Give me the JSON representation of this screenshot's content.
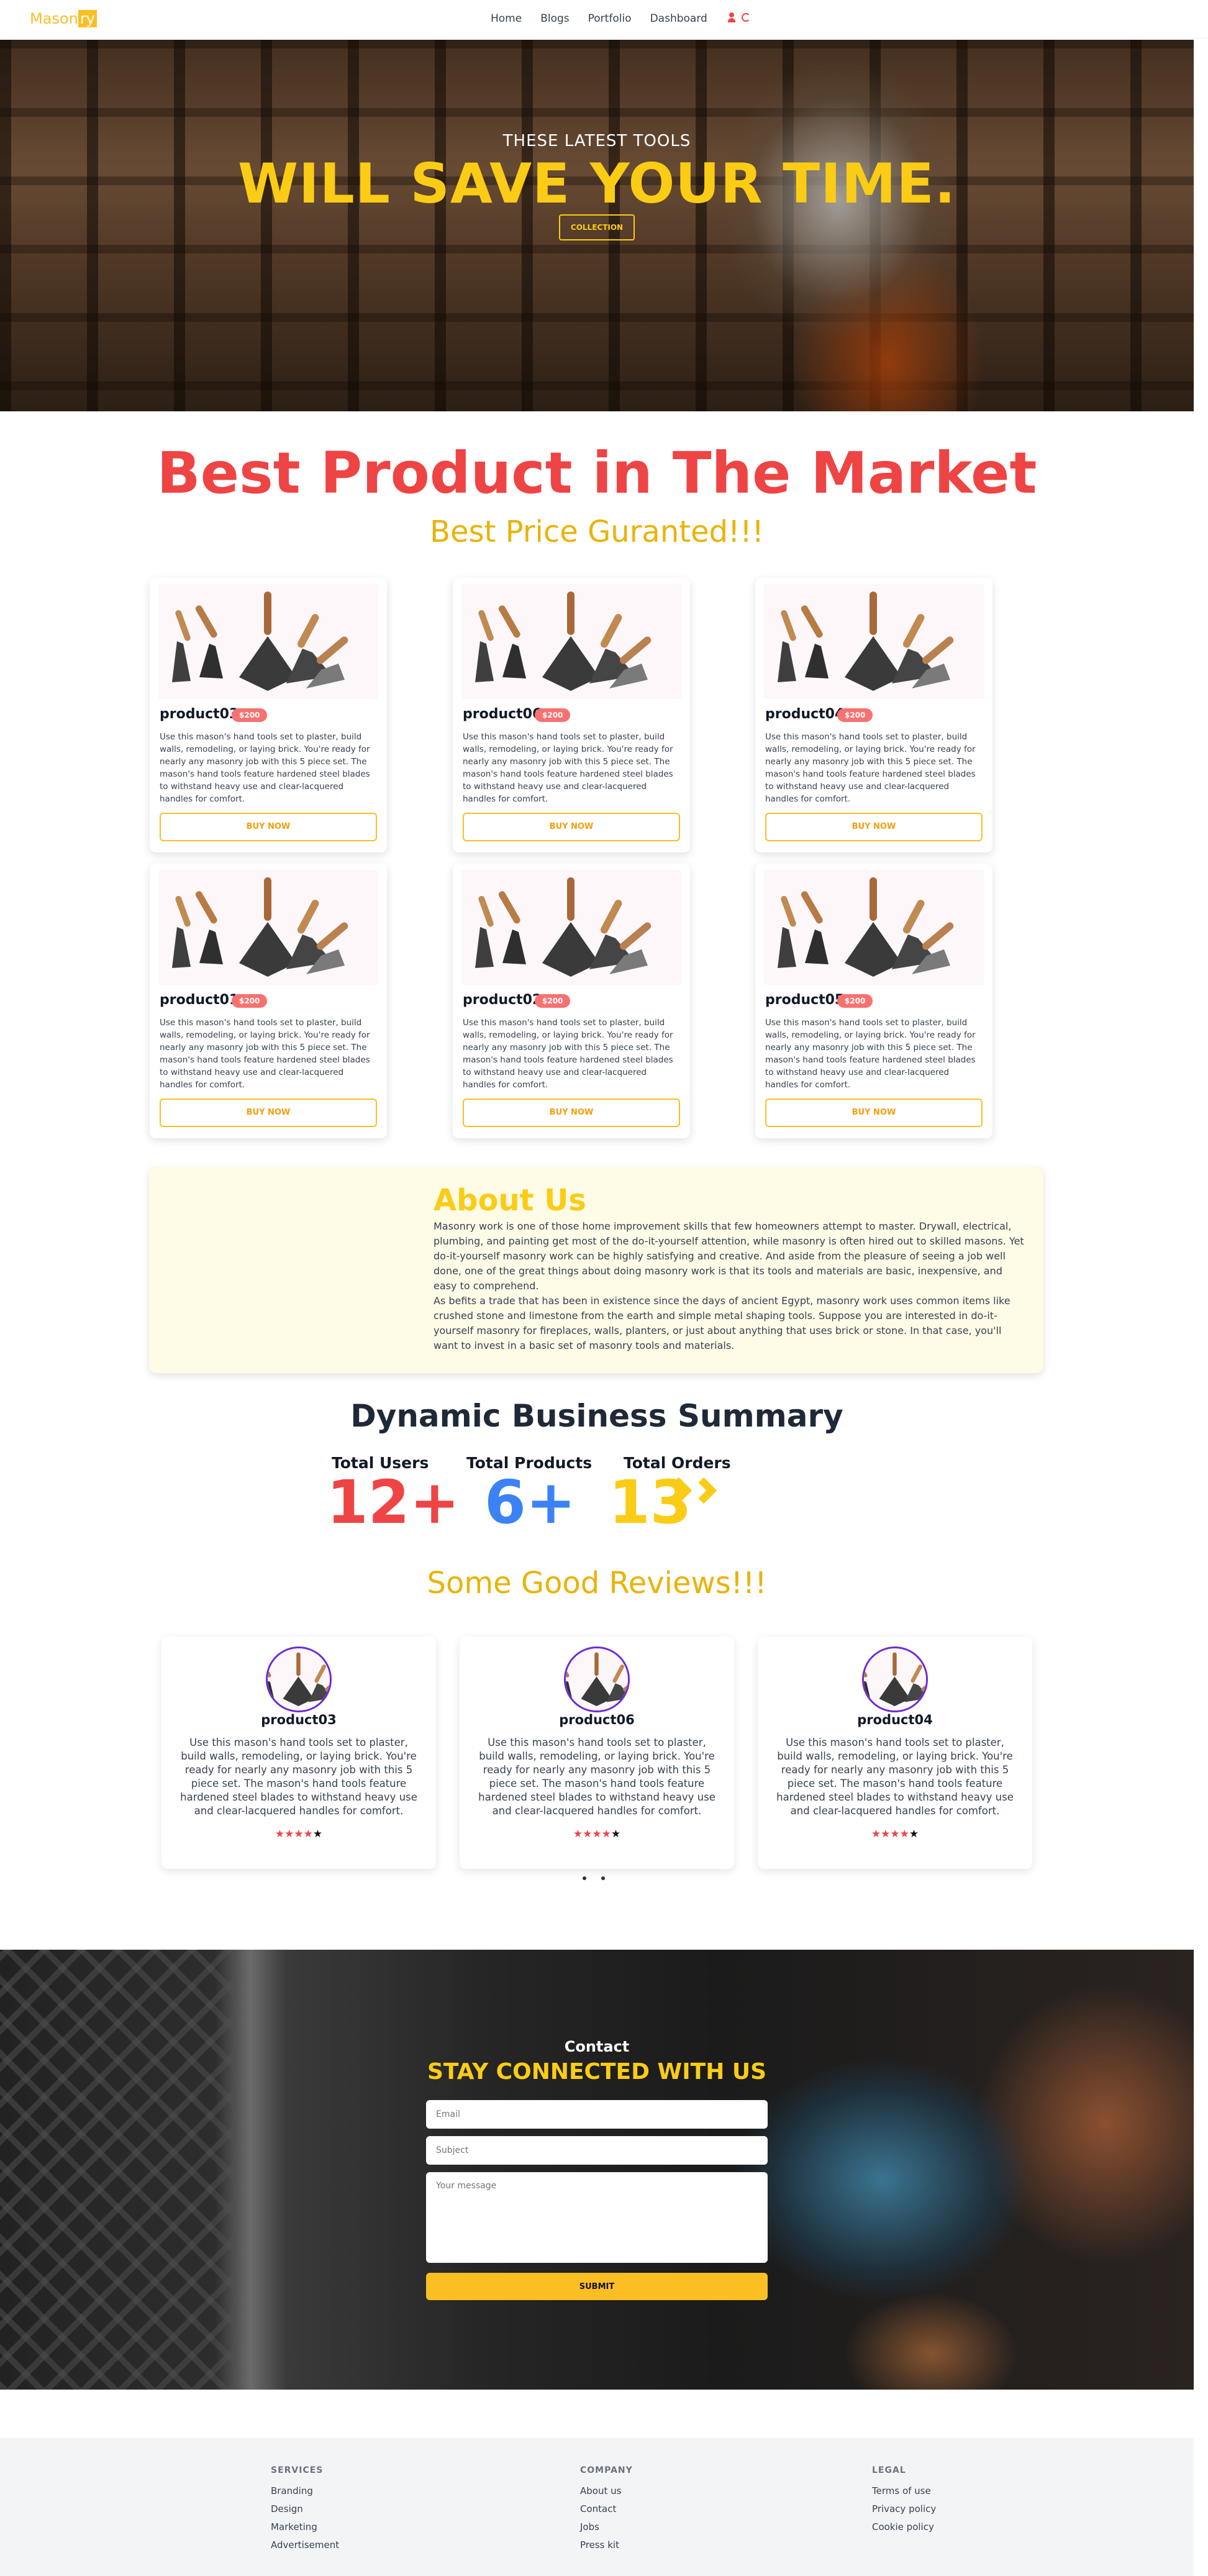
{
  "nav": {
    "logo_main": "Mason",
    "logo_box": "ry",
    "links": [
      "Home",
      "Blogs",
      "Portfolio",
      "Dashboard"
    ]
  },
  "hero": {
    "subtitle": "THESE LATEST TOOLS",
    "title": "WILL SAVE YOUR TIME.",
    "button": "COLLECTION"
  },
  "best": {
    "title": "Best Product in The Market",
    "subtitle": "Best Price Guranted!!!"
  },
  "products": [
    {
      "name": "product03",
      "price": "$200",
      "desc": "Use this mason's hand tools set to plaster, build walls, remodeling, or laying brick. You're ready for nearly any masonry job with this 5 piece set. The mason's hand tools feature hardened steel blades to withstand heavy use and clear-lacquered handles for comfort.",
      "button": "BUY NOW"
    },
    {
      "name": "product06",
      "price": "$200",
      "desc": "Use this mason's hand tools set to plaster, build walls, remodeling, or laying brick. You're ready for nearly any masonry job with this 5 piece set. The mason's hand tools feature hardened steel blades to withstand heavy use and clear-lacquered handles for comfort.",
      "button": "BUY NOW"
    },
    {
      "name": "product04",
      "price": "$200",
      "desc": "Use this mason's hand tools set to plaster, build walls, remodeling, or laying brick. You're ready for nearly any masonry job with this 5 piece set. The mason's hand tools feature hardened steel blades to withstand heavy use and clear-lacquered handles for comfort.",
      "button": "BUY NOW"
    },
    {
      "name": "product01",
      "price": "$200",
      "desc": "Use this mason's hand tools set to plaster, build walls, remodeling, or laying brick. You're ready for nearly any masonry job with this 5 piece set. The mason's hand tools feature hardened steel blades to withstand heavy use and clear-lacquered handles for comfort.",
      "button": "BUY NOW"
    },
    {
      "name": "product02",
      "price": "$200",
      "desc": "Use this mason's hand tools set to plaster, build walls, remodeling, or laying brick. You're ready for nearly any masonry job with this 5 piece set. The mason's hand tools feature hardened steel blades to withstand heavy use and clear-lacquered handles for comfort.",
      "button": "BUY NOW"
    },
    {
      "name": "product05",
      "price": "$200",
      "desc": "Use this mason's hand tools set to plaster, build walls, remodeling, or laying brick. You're ready for nearly any masonry job with this 5 piece set. The mason's hand tools feature hardened steel blades to withstand heavy use and clear-lacquered handles for comfort.",
      "button": "BUY NOW"
    }
  ],
  "about": {
    "title": "About Us",
    "p1": "Masonry work is one of those home improvement skills that few homeowners attempt to master. Drywall, electrical, plumbing, and painting get most of the do-it-yourself attention, while masonry is often hired out to skilled masons. Yet do-it-yourself masonry work can be highly satisfying and creative. And aside from the pleasure of seeing a job well done, one of the great things about doing masonry work is that its tools and materials are basic, inexpensive, and easy to comprehend.",
    "p2": "As befits a trade that has been in existence since the days of ancient Egypt, masonry work uses common items like crushed stone and limestone from the earth and simple metal shaping tools. Suppose you are interested in do-it-yourself masonry for fireplaces, walls, planters, or just about anything that uses brick or stone. In that case, you'll want to invest in a basic set of masonry tools and materials."
  },
  "summary": {
    "title": "Dynamic Business Summary",
    "stats": [
      {
        "label": "Total Users",
        "value": "12+",
        "color": "#ef4444"
      },
      {
        "label": "Total Products",
        "value": "6+",
        "color": "#3b82f6"
      },
      {
        "label": "Total Orders",
        "value": "13",
        "color": "#facc15"
      }
    ]
  },
  "reviews": {
    "title": "Some Good Reviews!!!",
    "items": [
      {
        "name": "product03",
        "text": "Use this mason's hand tools set to plaster, build walls, remodeling, or laying brick. You're ready for nearly any masonry job with this 5 piece set. The mason's hand tools feature hardened steel blades to withstand heavy use and clear-lacquered handles for comfort.",
        "rating": 4.5
      },
      {
        "name": "product06",
        "text": "Use this mason's hand tools set to plaster, build walls, remodeling, or laying brick. You're ready for nearly any masonry job with this 5 piece set. The mason's hand tools feature hardened steel blades to withstand heavy use and clear-lacquered handles for comfort.",
        "rating": 4.5
      },
      {
        "name": "product04",
        "text": "Use this mason's hand tools set to plaster, build walls, remodeling, or laying brick. You're ready for nearly any masonry job with this 5 piece set. The mason's hand tools feature hardened steel blades to withstand heavy use and clear-lacquered handles for comfort.",
        "rating": 4.5
      }
    ]
  },
  "contact": {
    "label": "Contact",
    "title": "STAY CONNECTED WITH US",
    "email_placeholder": "Email",
    "subject_placeholder": "Subject",
    "message_placeholder": "Your message",
    "submit": "SUBMIT"
  },
  "footer": {
    "services": {
      "title": "SERVICES",
      "links": [
        "Branding",
        "Design",
        "Marketing",
        "Advertisement"
      ]
    },
    "company": {
      "title": "COMPANY",
      "links": [
        "About us",
        "Contact",
        "Jobs",
        "Press kit"
      ]
    },
    "legal": {
      "title": "LEGAL",
      "links": [
        "Terms of use",
        "Privacy policy",
        "Cookie policy"
      ]
    }
  },
  "colors": {
    "accent": "#facc15",
    "red": "#ef4444",
    "blue": "#3b82f6"
  }
}
